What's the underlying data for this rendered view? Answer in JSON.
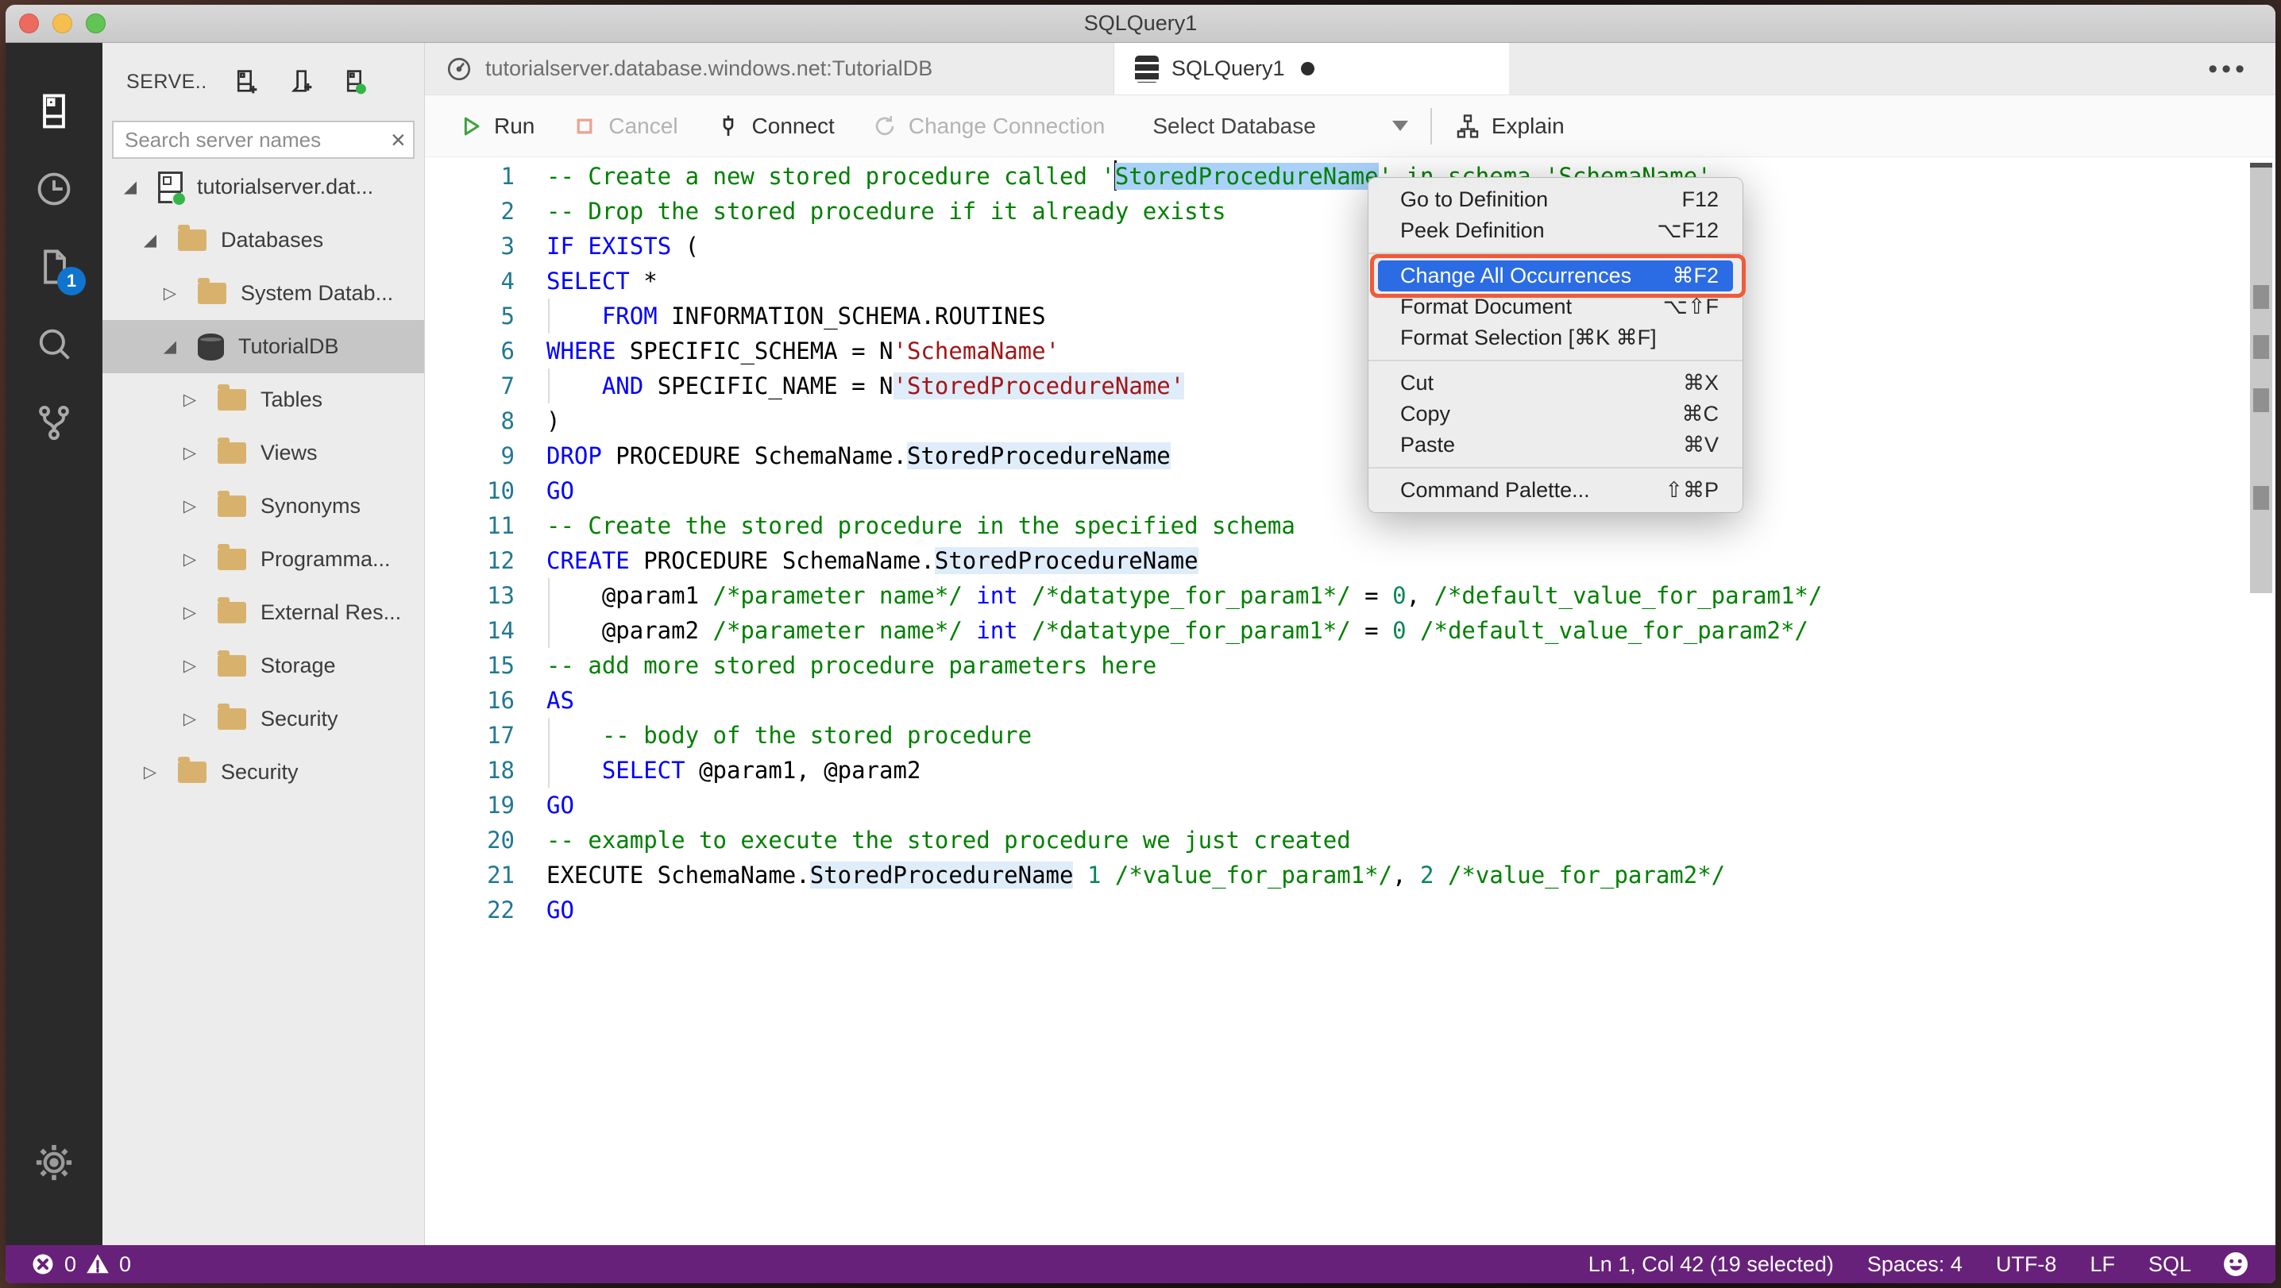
{
  "titlebar": {
    "title": "SQLQuery1"
  },
  "activitybar": {
    "items": [
      "servers",
      "task-history",
      "notebooks",
      "search",
      "source-control",
      "settings"
    ],
    "notebooks_badge": "1"
  },
  "sidebar": {
    "header": {
      "title": "SERVE..",
      "icons": [
        "new-connection",
        "new-server-group",
        "active-connections"
      ]
    },
    "search": {
      "placeholder": "Search server names",
      "clear_glyph": "×"
    },
    "tree": [
      {
        "label": "tutorialserver.dat...",
        "icon": "server",
        "level": 0,
        "expanded": true
      },
      {
        "label": "Databases",
        "icon": "folder",
        "level": 1,
        "expanded": true
      },
      {
        "label": "System Datab...",
        "icon": "folder",
        "level": 2,
        "expanded": false
      },
      {
        "label": "TutorialDB",
        "icon": "database",
        "level": 2,
        "expanded": true,
        "selected": true
      },
      {
        "label": "Tables",
        "icon": "folder",
        "level": 3,
        "expanded": false
      },
      {
        "label": "Views",
        "icon": "folder",
        "level": 3,
        "expanded": false
      },
      {
        "label": "Synonyms",
        "icon": "folder",
        "level": 3,
        "expanded": false
      },
      {
        "label": "Programma...",
        "icon": "folder",
        "level": 3,
        "expanded": false
      },
      {
        "label": "External Res...",
        "icon": "folder",
        "level": 3,
        "expanded": false
      },
      {
        "label": "Storage",
        "icon": "folder",
        "level": 3,
        "expanded": false
      },
      {
        "label": "Security",
        "icon": "folder",
        "level": 3,
        "expanded": false
      },
      {
        "label": "Security",
        "icon": "folder",
        "level": 1,
        "expanded": false
      }
    ]
  },
  "tabs": [
    {
      "title": "tutorialserver.database.windows.net:TutorialDB",
      "icon": "dashboard",
      "active": false,
      "dirty": false
    },
    {
      "title": "SQLQuery1",
      "icon": "database-stack",
      "active": true,
      "dirty": true
    }
  ],
  "toolbar": {
    "run": "Run",
    "cancel": "Cancel",
    "connect": "Connect",
    "change_connection": "Change Connection",
    "select_database": "Select Database",
    "explain": "Explain"
  },
  "editor": {
    "code_lines": [
      {
        "n": 1,
        "tokens": [
          {
            "c": "comment",
            "t": "-- Create a new stored procedure called '"
          },
          {
            "cursor": true
          },
          {
            "c": "comment",
            "t": "StoredProcedureName",
            "h": "sel"
          },
          {
            "c": "comment",
            "t": "' in schema 'SchemaName'"
          }
        ]
      },
      {
        "n": 2,
        "tokens": [
          {
            "c": "comment",
            "t": "-- Drop the stored procedure if it already exists"
          }
        ]
      },
      {
        "n": 3,
        "tokens": [
          {
            "c": "keyword",
            "t": "IF"
          },
          {
            "c": "plain",
            "t": " "
          },
          {
            "c": "keyword",
            "t": "EXISTS"
          },
          {
            "c": "plain",
            "t": " ("
          }
        ]
      },
      {
        "n": 4,
        "tokens": [
          {
            "c": "keyword",
            "t": "SELECT"
          },
          {
            "c": "plain",
            "t": " *"
          }
        ]
      },
      {
        "n": 5,
        "guide": true,
        "tokens": [
          {
            "c": "plain",
            "t": "    "
          },
          {
            "c": "keyword",
            "t": "FROM"
          },
          {
            "c": "plain",
            "t": " INFORMATION_SCHEMA.ROUTINES"
          }
        ]
      },
      {
        "n": 6,
        "tokens": [
          {
            "c": "keyword",
            "t": "WHERE"
          },
          {
            "c": "plain",
            "t": " SPECIFIC_SCHEMA = N"
          },
          {
            "c": "string",
            "t": "'SchemaName'"
          }
        ]
      },
      {
        "n": 7,
        "guide": true,
        "tokens": [
          {
            "c": "plain",
            "t": "    "
          },
          {
            "c": "keyword",
            "t": "AND"
          },
          {
            "c": "plain",
            "t": " SPECIFIC_NAME = N"
          },
          {
            "c": "string",
            "t": "'StoredProcedureName'",
            "h": "occ"
          }
        ]
      },
      {
        "n": 8,
        "tokens": [
          {
            "c": "plain",
            "t": ")"
          }
        ]
      },
      {
        "n": 9,
        "tokens": [
          {
            "c": "keyword",
            "t": "DROP"
          },
          {
            "c": "plain",
            "t": " PROCEDURE SchemaName."
          },
          {
            "c": "plain",
            "t": "StoredProcedureName",
            "h": "occ"
          }
        ]
      },
      {
        "n": 10,
        "tokens": [
          {
            "c": "keyword",
            "t": "GO"
          }
        ]
      },
      {
        "n": 11,
        "tokens": [
          {
            "c": "comment",
            "t": "-- Create the stored procedure in the specified schema"
          }
        ]
      },
      {
        "n": 12,
        "tokens": [
          {
            "c": "keyword",
            "t": "CREATE"
          },
          {
            "c": "plain",
            "t": " PROCEDURE SchemaName."
          },
          {
            "c": "plain",
            "t": "StoredProcedureName",
            "h": "occ"
          }
        ]
      },
      {
        "n": 13,
        "guide": true,
        "tokens": [
          {
            "c": "plain",
            "t": "    @param1 "
          },
          {
            "c": "comment",
            "t": "/*parameter name*/"
          },
          {
            "c": "plain",
            "t": " "
          },
          {
            "c": "keyword",
            "t": "int"
          },
          {
            "c": "plain",
            "t": " "
          },
          {
            "c": "comment",
            "t": "/*datatype_for_param1*/"
          },
          {
            "c": "plain",
            "t": " = "
          },
          {
            "c": "number",
            "t": "0"
          },
          {
            "c": "plain",
            "t": ", "
          },
          {
            "c": "comment",
            "t": "/*default_value_for_param1*/"
          }
        ]
      },
      {
        "n": 14,
        "guide": true,
        "tokens": [
          {
            "c": "plain",
            "t": "    @param2 "
          },
          {
            "c": "comment",
            "t": "/*parameter name*/"
          },
          {
            "c": "plain",
            "t": " "
          },
          {
            "c": "keyword",
            "t": "int"
          },
          {
            "c": "plain",
            "t": " "
          },
          {
            "c": "comment",
            "t": "/*datatype_for_param1*/"
          },
          {
            "c": "plain",
            "t": " = "
          },
          {
            "c": "number",
            "t": "0"
          },
          {
            "c": "plain",
            "t": " "
          },
          {
            "c": "comment",
            "t": "/*default_value_for_param2*/"
          }
        ]
      },
      {
        "n": 15,
        "tokens": [
          {
            "c": "comment",
            "t": "-- add more stored procedure parameters here"
          }
        ]
      },
      {
        "n": 16,
        "tokens": [
          {
            "c": "keyword",
            "t": "AS"
          }
        ]
      },
      {
        "n": 17,
        "guide": true,
        "tokens": [
          {
            "c": "plain",
            "t": "    "
          },
          {
            "c": "comment",
            "t": "-- body of the stored procedure"
          }
        ]
      },
      {
        "n": 18,
        "guide": true,
        "tokens": [
          {
            "c": "plain",
            "t": "    "
          },
          {
            "c": "keyword",
            "t": "SELECT"
          },
          {
            "c": "plain",
            "t": " @param1, @param2"
          }
        ]
      },
      {
        "n": 19,
        "tokens": [
          {
            "c": "keyword",
            "t": "GO"
          }
        ]
      },
      {
        "n": 20,
        "tokens": [
          {
            "c": "comment",
            "t": "-- example to execute the stored procedure we just created"
          }
        ]
      },
      {
        "n": 21,
        "tokens": [
          {
            "c": "plain",
            "t": "EXECUTE SchemaName."
          },
          {
            "c": "plain",
            "t": "StoredProcedureName",
            "h": "occ"
          },
          {
            "c": "plain",
            "t": " "
          },
          {
            "c": "number",
            "t": "1"
          },
          {
            "c": "plain",
            "t": " "
          },
          {
            "c": "comment",
            "t": "/*value_for_param1*/"
          },
          {
            "c": "plain",
            "t": ", "
          },
          {
            "c": "number",
            "t": "2"
          },
          {
            "c": "plain",
            "t": " "
          },
          {
            "c": "comment",
            "t": "/*value_for_param2*/"
          }
        ]
      },
      {
        "n": 22,
        "tokens": [
          {
            "c": "keyword",
            "t": "GO"
          }
        ]
      }
    ],
    "syntax_colors": {
      "comment": "#008000",
      "keyword": "#0000ff",
      "string": "#a31515",
      "number": "#098658",
      "selection": "#a9d1fa",
      "occurrence": "#dfecf9",
      "line_number": "#237893"
    }
  },
  "context_menu": {
    "items": [
      {
        "label": "Go to Definition",
        "shortcut": "F12"
      },
      {
        "label": "Peek Definition",
        "shortcut": "⌥F12"
      },
      {
        "separator": true
      },
      {
        "label": "Change All Occurrences",
        "shortcut": "⌘F2",
        "highlighted": true,
        "annotated": true
      },
      {
        "label": "Format Document",
        "shortcut": "⌥⇧F"
      },
      {
        "label": "Format Selection [⌘K ⌘F]",
        "shortcut": ""
      },
      {
        "separator": true
      },
      {
        "label": "Cut",
        "shortcut": "⌘X"
      },
      {
        "label": "Copy",
        "shortcut": "⌘C"
      },
      {
        "label": "Paste",
        "shortcut": "⌘V"
      },
      {
        "separator": true
      },
      {
        "label": "Command Palette...",
        "shortcut": "⇧⌘P"
      }
    ],
    "highlight_color": "#2b6be4",
    "annotation_color": "#ef5b3a"
  },
  "statusbar": {
    "background": "#68217a",
    "problems": {
      "errors": "0",
      "warnings": "0"
    },
    "right_items": [
      "Ln 1, Col 42 (19 selected)",
      "Spaces: 4",
      "UTF-8",
      "LF",
      "SQL"
    ]
  }
}
